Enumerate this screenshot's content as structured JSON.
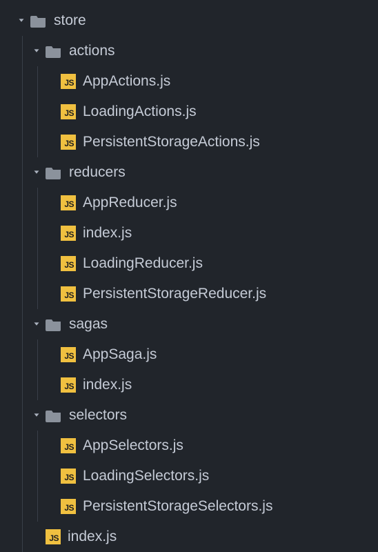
{
  "root": {
    "name": "store",
    "children": [
      {
        "name": "actions",
        "children": [
          {
            "name": "AppActions.js"
          },
          {
            "name": "LoadingActions.js"
          },
          {
            "name": "PersistentStorageActions.js"
          }
        ]
      },
      {
        "name": "reducers",
        "children": [
          {
            "name": "AppReducer.js"
          },
          {
            "name": "index.js"
          },
          {
            "name": "LoadingReducer.js"
          },
          {
            "name": "PersistentStorageReducer.js"
          }
        ]
      },
      {
        "name": "sagas",
        "children": [
          {
            "name": "AppSaga.js"
          },
          {
            "name": "index.js"
          }
        ]
      },
      {
        "name": "selectors",
        "children": [
          {
            "name": "AppSelectors.js"
          },
          {
            "name": "LoadingSelectors.js"
          },
          {
            "name": "PersistentStorageSelectors.js"
          }
        ]
      },
      {
        "name": "index.js"
      }
    ]
  }
}
